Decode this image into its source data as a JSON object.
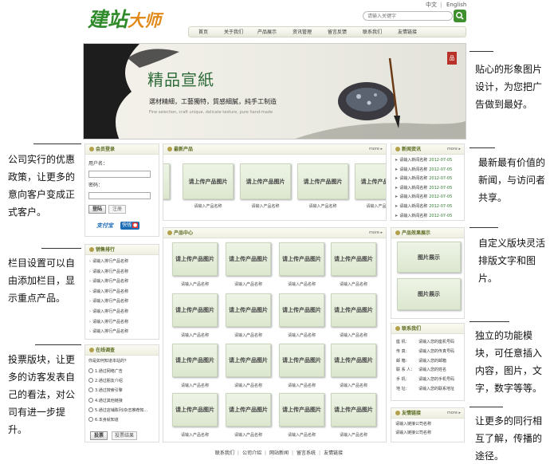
{
  "topbar": {
    "lang_cn": "中文",
    "sep": "|",
    "lang_en": "English"
  },
  "logo": {
    "part1": "建站",
    "part2": "大师"
  },
  "search": {
    "placeholder": "请输入关键字"
  },
  "nav": [
    "首页",
    "关于我们",
    "产品展示",
    "资讯管理",
    "留言反馈",
    "联系我们",
    "友情链接"
  ],
  "banner": {
    "seal": "品",
    "title": "精品宣紙",
    "subtitle": "選材精細，工藝獨特，質感細膩，純手工制造",
    "en": "Fine selection, craft unique, delicate texture, pure hand-made"
  },
  "login": {
    "title": "会员登录",
    "user_label": "用户名：",
    "pass_label": "密码：",
    "login_btn": "登陆",
    "register_btn": "注册",
    "pay1": "支付宝",
    "pay2": "快钱"
  },
  "sales": {
    "title": "销售排行",
    "items": [
      "请输入排行产品名称",
      "请输入排行产品名称",
      "请输入排行产品名称",
      "请输入排行产品名称",
      "请输入排行产品名称",
      "请输入排行产品名称",
      "请输入排行产品名称",
      "请输入排行产品名称"
    ]
  },
  "survey": {
    "title": "在线调查",
    "question": "你是如何知道本站的？",
    "options": [
      "1.通过网络广告",
      "2.通过朋友介绍",
      "3.通过搜索引擎",
      "4.通过其他链接",
      "5.通过店铺陈列/杂志推荐知...",
      "6.本身就知道"
    ],
    "vote_btn": "投票",
    "result_btn": "投票结果"
  },
  "latest": {
    "title": "最新产品",
    "more": "more ▸",
    "placeholder": "请上传产品图片",
    "caption": "请输入产品名称"
  },
  "news": {
    "title": "新闻资讯",
    "more": "more ▸",
    "items": [
      {
        "text": "请输入新闻名称",
        "date": "2012-07-05"
      },
      {
        "text": "请输入新闻名称",
        "date": "2012-07-05"
      },
      {
        "text": "请输入新闻名称",
        "date": "2012-07-05"
      },
      {
        "text": "请输入新闻名称",
        "date": "2012-07-05"
      },
      {
        "text": "请输入新闻名称",
        "date": "2012-07-05"
      },
      {
        "text": "请输入新闻名称",
        "date": "2012-07-05"
      },
      {
        "text": "请输入新闻名称",
        "date": "2012-07-05"
      }
    ]
  },
  "products": {
    "title": "产品中心",
    "more": "more ▸",
    "placeholder": "请上传产品图片",
    "caption": "请输入产品名称"
  },
  "effect": {
    "title": "产品效果展示",
    "img": "图片展示"
  },
  "contact": {
    "title": "联系我们",
    "rows": [
      {
        "k": "座    机：",
        "v": "请输入您的座机号码"
      },
      {
        "k": "传    真：",
        "v": "请输入您的传真号码"
      },
      {
        "k": "邮    箱：",
        "v": "请输入您的邮箱"
      },
      {
        "k": "联 系 人：",
        "v": "请输入您的姓名"
      },
      {
        "k": "手    机：",
        "v": "请输入您的手机号码"
      },
      {
        "k": "地    址：",
        "v": "请输入您的联系地址"
      }
    ]
  },
  "links": {
    "title": "友情链接",
    "more": "more ▸",
    "items": [
      "请输入链接公司名称",
      "请输入链接公司名称"
    ]
  },
  "footer": [
    "联系我们",
    "|",
    "公司介绍",
    "|",
    "网站新闻",
    "|",
    "留言系统",
    "|",
    "友情链接"
  ],
  "annotations": [
    "贴心的形象图片设计，为您把广告做到最好。",
    "最新最有价值的新闻，与访问者共享。",
    "自定义版块灵活排版文字和图片。",
    "独立的功能模块，可任意插入内容，图片，文字，数字等等。",
    "让更多的同行相互了解，传播的途径。",
    "公司实行的优惠政策，让更多的意向客户变成正式客户。",
    "栏目设置可以自由添加栏目，显示重点产品。",
    "投票版块，让更多的访客发表自己的看法，对公司有进一步提升。"
  ]
}
